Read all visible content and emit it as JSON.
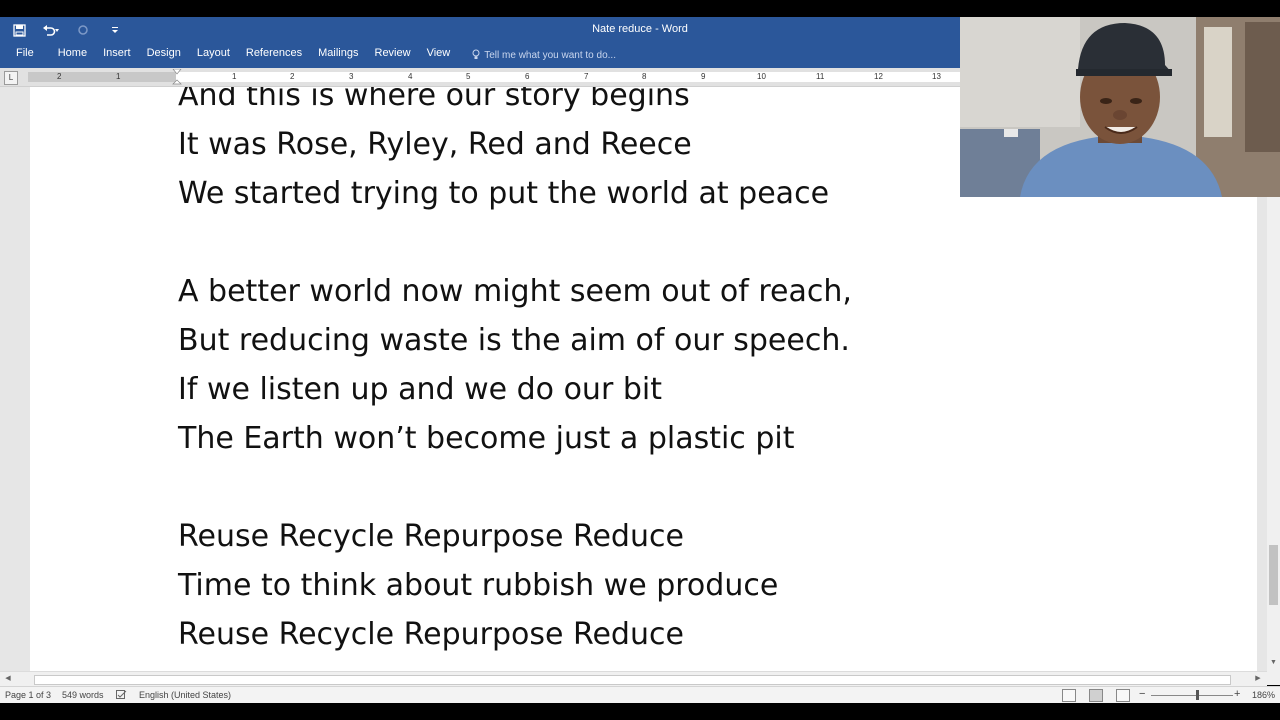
{
  "window": {
    "title": "Nate reduce - Word"
  },
  "quick_access": {
    "save_icon": "save-icon",
    "undo_icon": "undo-icon",
    "redo_icon": "redo-icon",
    "customize_icon": "customize-qat-icon"
  },
  "ribbon": {
    "tabs": [
      "File",
      "Home",
      "Insert",
      "Design",
      "Layout",
      "References",
      "Mailings",
      "Review",
      "View"
    ],
    "tell_me": "Tell me what you want to do..."
  },
  "ruler": {
    "left_numbers": [
      "2",
      "1"
    ],
    "right_numbers": [
      "1",
      "2",
      "3",
      "4",
      "5",
      "6",
      "7",
      "8",
      "9",
      "10",
      "11",
      "12",
      "13"
    ]
  },
  "document": {
    "lines": [
      "And this is where our story begins",
      "It was Rose, Ryley, Red and Reece",
      "We started trying to put the world at peace",
      "",
      "A better world now might seem out of reach,",
      "But reducing waste is the aim of our speech.",
      "If we listen up and we do our bit",
      "The Earth won’t become just a plastic pit",
      "",
      "Reuse Recycle Repurpose Reduce",
      "Time to think about rubbish we produce",
      "Reuse Recycle Repurpose Reduce"
    ]
  },
  "status_bar": {
    "page": "Page 1 of 3",
    "words": "549 words",
    "language": "English (United States)",
    "zoom": "186%"
  },
  "colors": {
    "ribbon": "#2b579a",
    "page": "#ffffff",
    "canvas": "#e6e6e6"
  }
}
